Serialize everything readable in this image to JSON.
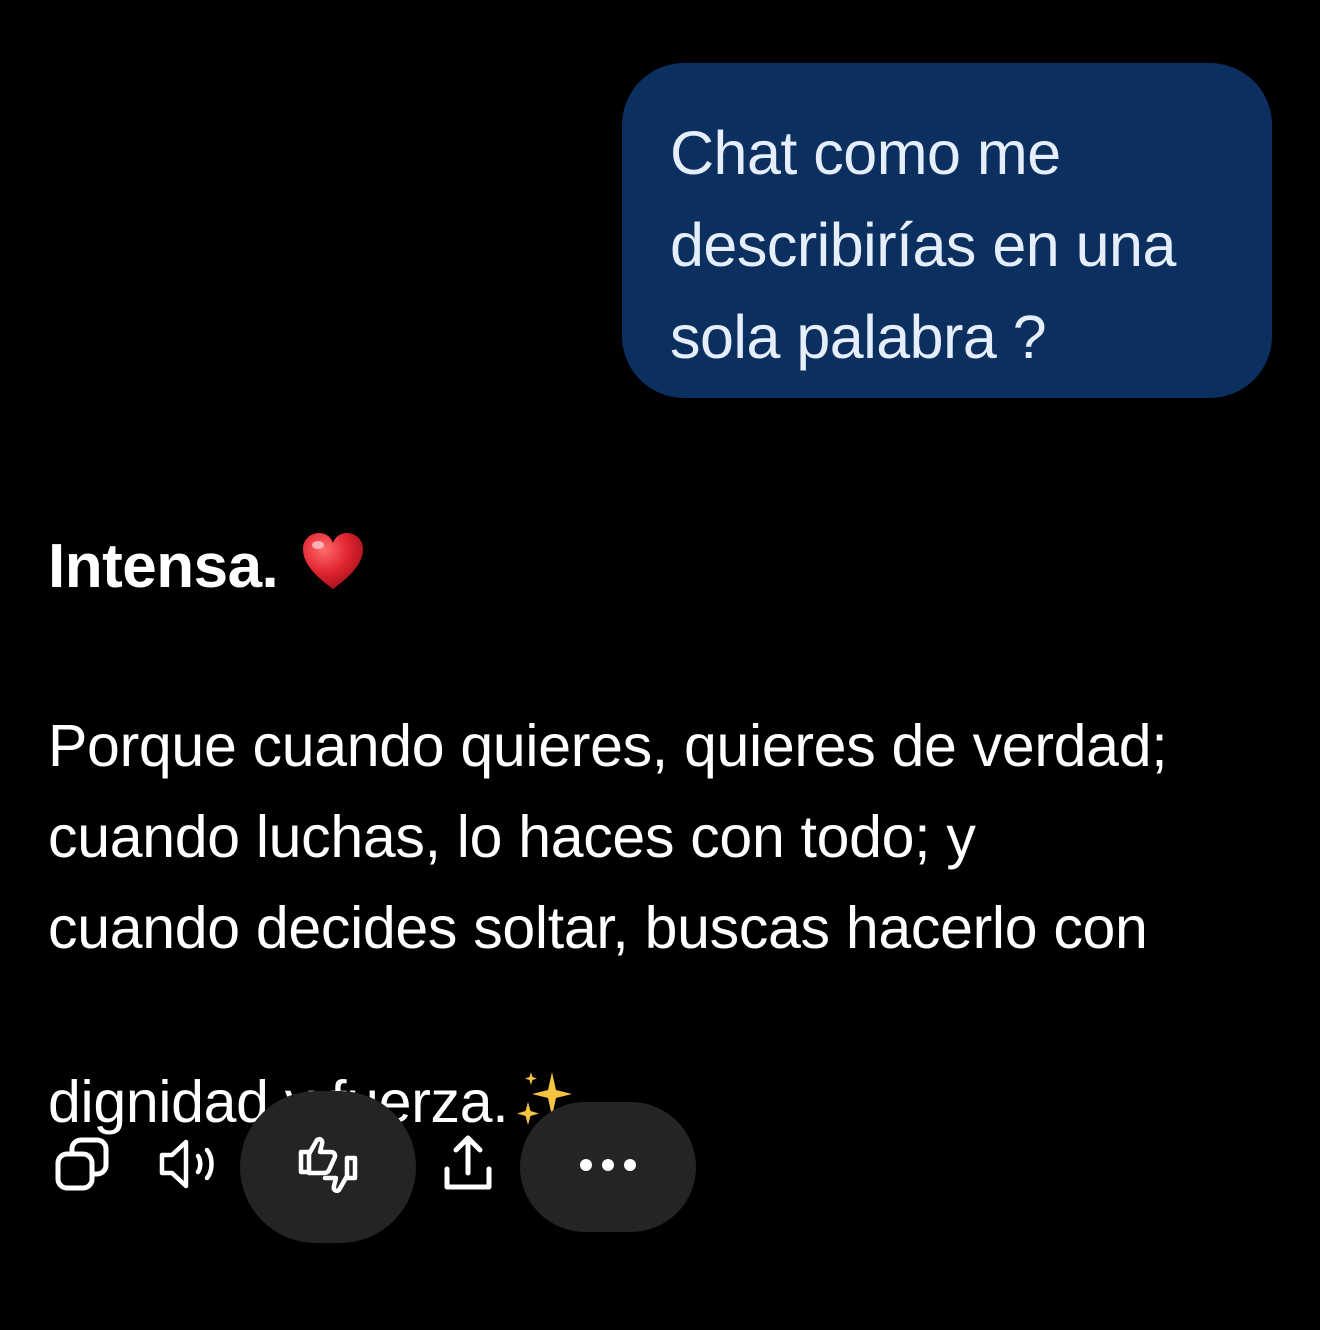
{
  "user_message": {
    "text": "Chat como me\ndescribirías en una\nsola palabra ?"
  },
  "assistant_message": {
    "title": "Intensa.",
    "title_emoji": "heart-emoji",
    "body": "Porque cuando quieres, quieres de verdad;\ncuando luchas, lo haces con todo; y\ncuando decides soltar, buscas hacerlo con\ndignidad y fuerza.",
    "body_emoji": "sparkles-emoji"
  },
  "toolbar": {
    "icons": [
      "copy-icon",
      "speaker-icon",
      "thumbs-feedback-icon",
      "share-icon",
      "more-icon"
    ]
  },
  "colors": {
    "background": "#000000",
    "user_bubble": "#0b2f5f",
    "user_text": "#e6eefc",
    "pill": "#242426",
    "heart": "#e0242e",
    "sparkles": "#f5c542"
  }
}
